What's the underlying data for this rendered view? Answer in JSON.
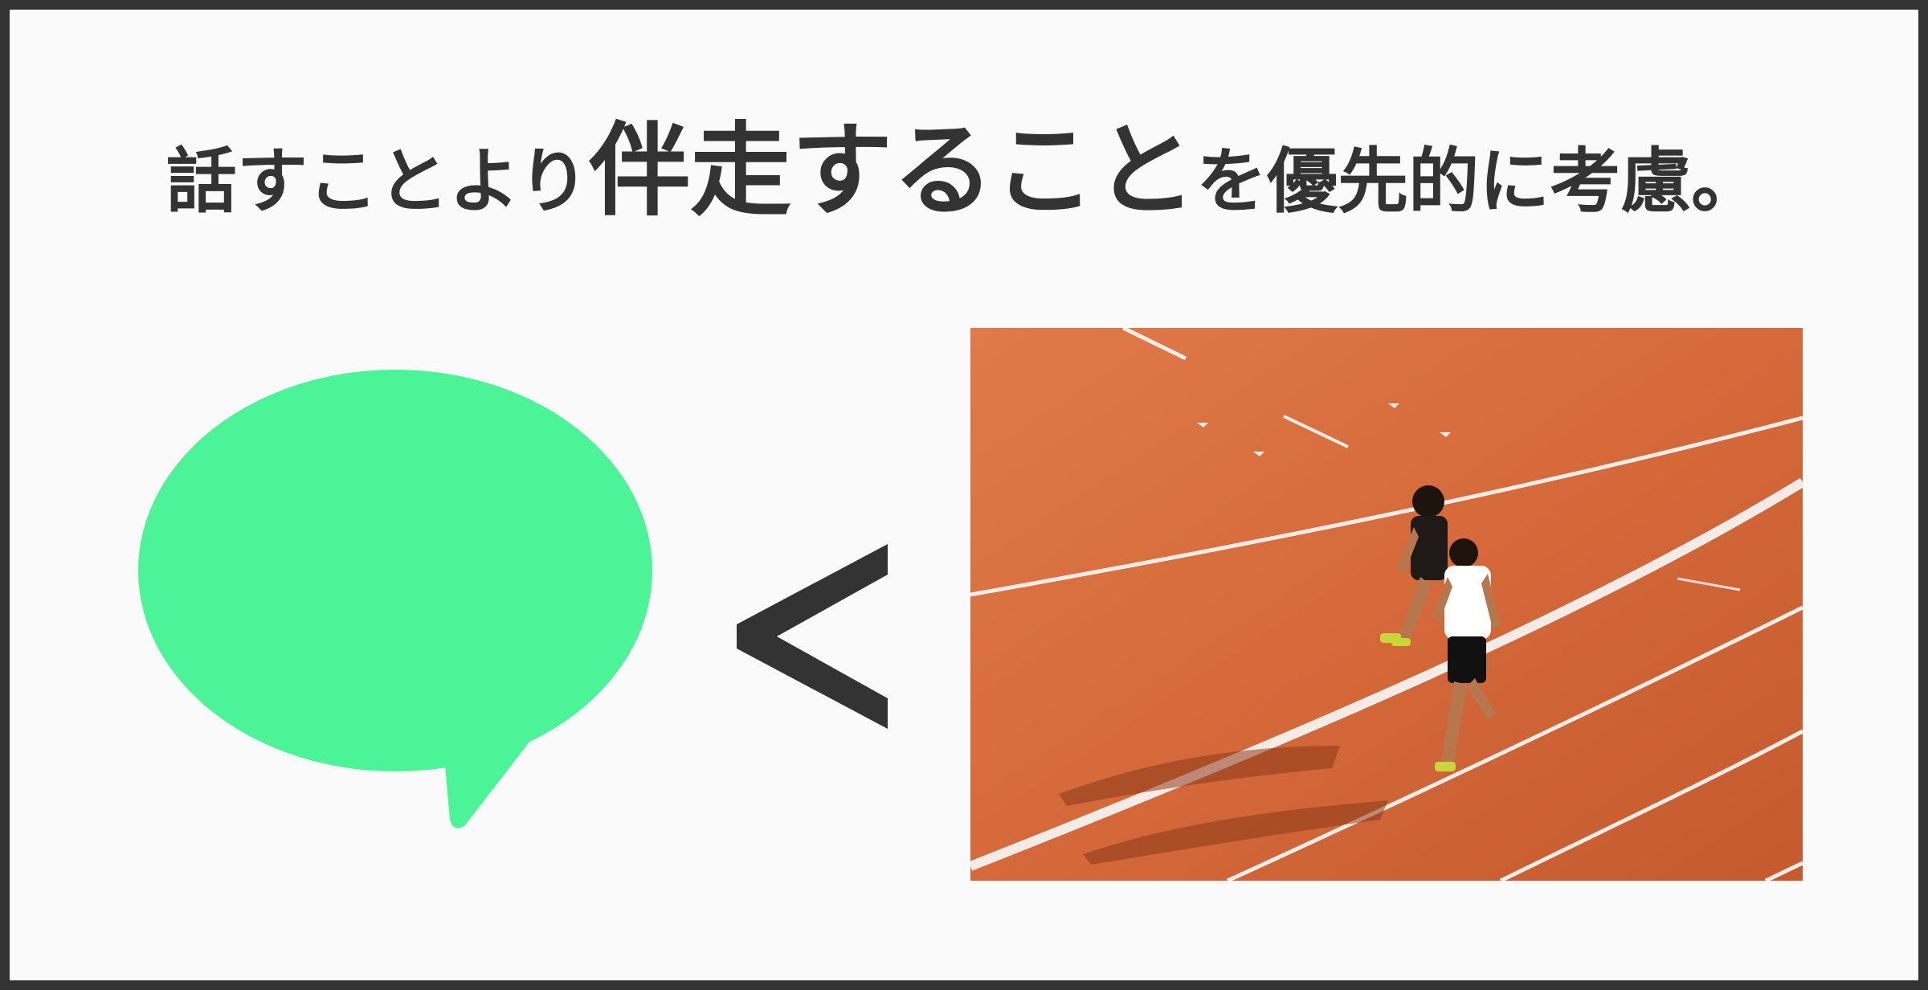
{
  "headline": {
    "part1": "話すことより",
    "emphasis": "伴走すること",
    "part2": "を優先的に考慮。"
  },
  "icons": {
    "bubble": "speech-bubble-icon",
    "comparison": "less-than-sign"
  },
  "colors": {
    "frame": "#333333",
    "background": "#fafafa",
    "bubble": "#4af497",
    "text": "#333333",
    "track": "#d4693a"
  }
}
